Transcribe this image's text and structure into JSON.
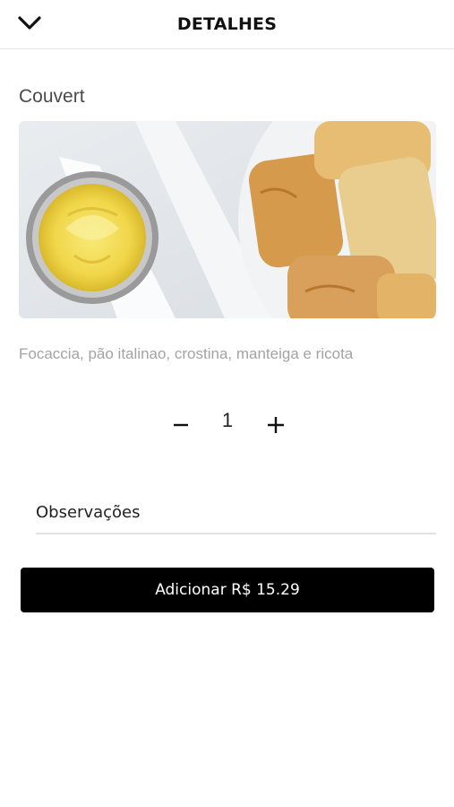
{
  "header": {
    "title": "DETALHES",
    "back_icon": "chevron-down-icon"
  },
  "product": {
    "name": "Couvert",
    "description": "Focaccia, pão italinao, crostina, manteiga e ricota"
  },
  "quantity": {
    "value": "1",
    "minus_icon": "minus-icon",
    "plus_icon": "plus-icon"
  },
  "notes": {
    "placeholder": "Observações",
    "value": ""
  },
  "add_button": {
    "label": "Adicionar R$ 15.29"
  },
  "colors": {
    "button_bg": "#000000",
    "button_text": "#ffffff",
    "description_text": "#a3a3a3"
  }
}
